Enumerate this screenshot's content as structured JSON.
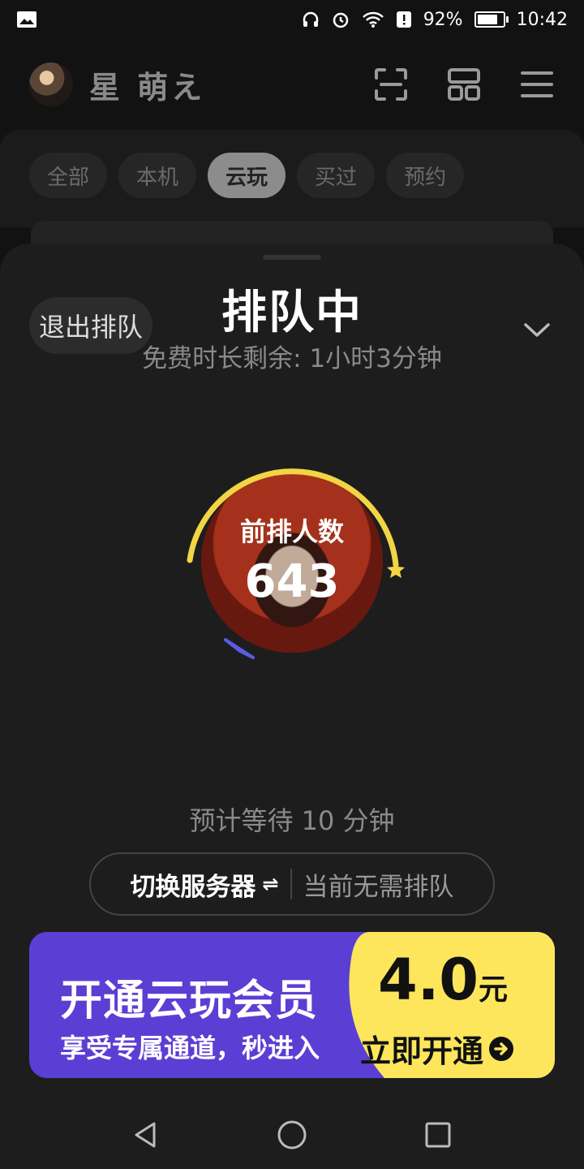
{
  "status_bar": {
    "battery": "92%",
    "time": "10:42"
  },
  "header": {
    "username": "星 萌え",
    "icons": [
      "avatar",
      "scan-icon",
      "grid-icon",
      "menu-icon"
    ]
  },
  "tabs": [
    {
      "label": "全部",
      "active": false
    },
    {
      "label": "本机",
      "active": false
    },
    {
      "label": "云玩",
      "active": true
    },
    {
      "label": "买过",
      "active": false
    },
    {
      "label": "预约",
      "active": false
    }
  ],
  "queue_sheet": {
    "exit_label": "退出排队",
    "title": "排队中",
    "subtitle": "免费时长剩余: 1小时3分钟",
    "ring_label": "前排人数",
    "ring_count": "643",
    "wait_text": "预计等待 10 分钟",
    "switch_server_label": "切换服务器",
    "switch_icon": "⇌",
    "server_status": "当前无需排队"
  },
  "member_banner": {
    "title": "开通云玩会员",
    "subtitle": "享受专属通道，秒进入",
    "price_value": "4.0",
    "price_unit": "元",
    "cta_label": "立即开通",
    "colors": {
      "purple": "#5b3fd4",
      "yellow": "#fde65c"
    }
  },
  "colors": {
    "ring_arc": "#f2d544",
    "ring_tail": "#5b5be6"
  }
}
